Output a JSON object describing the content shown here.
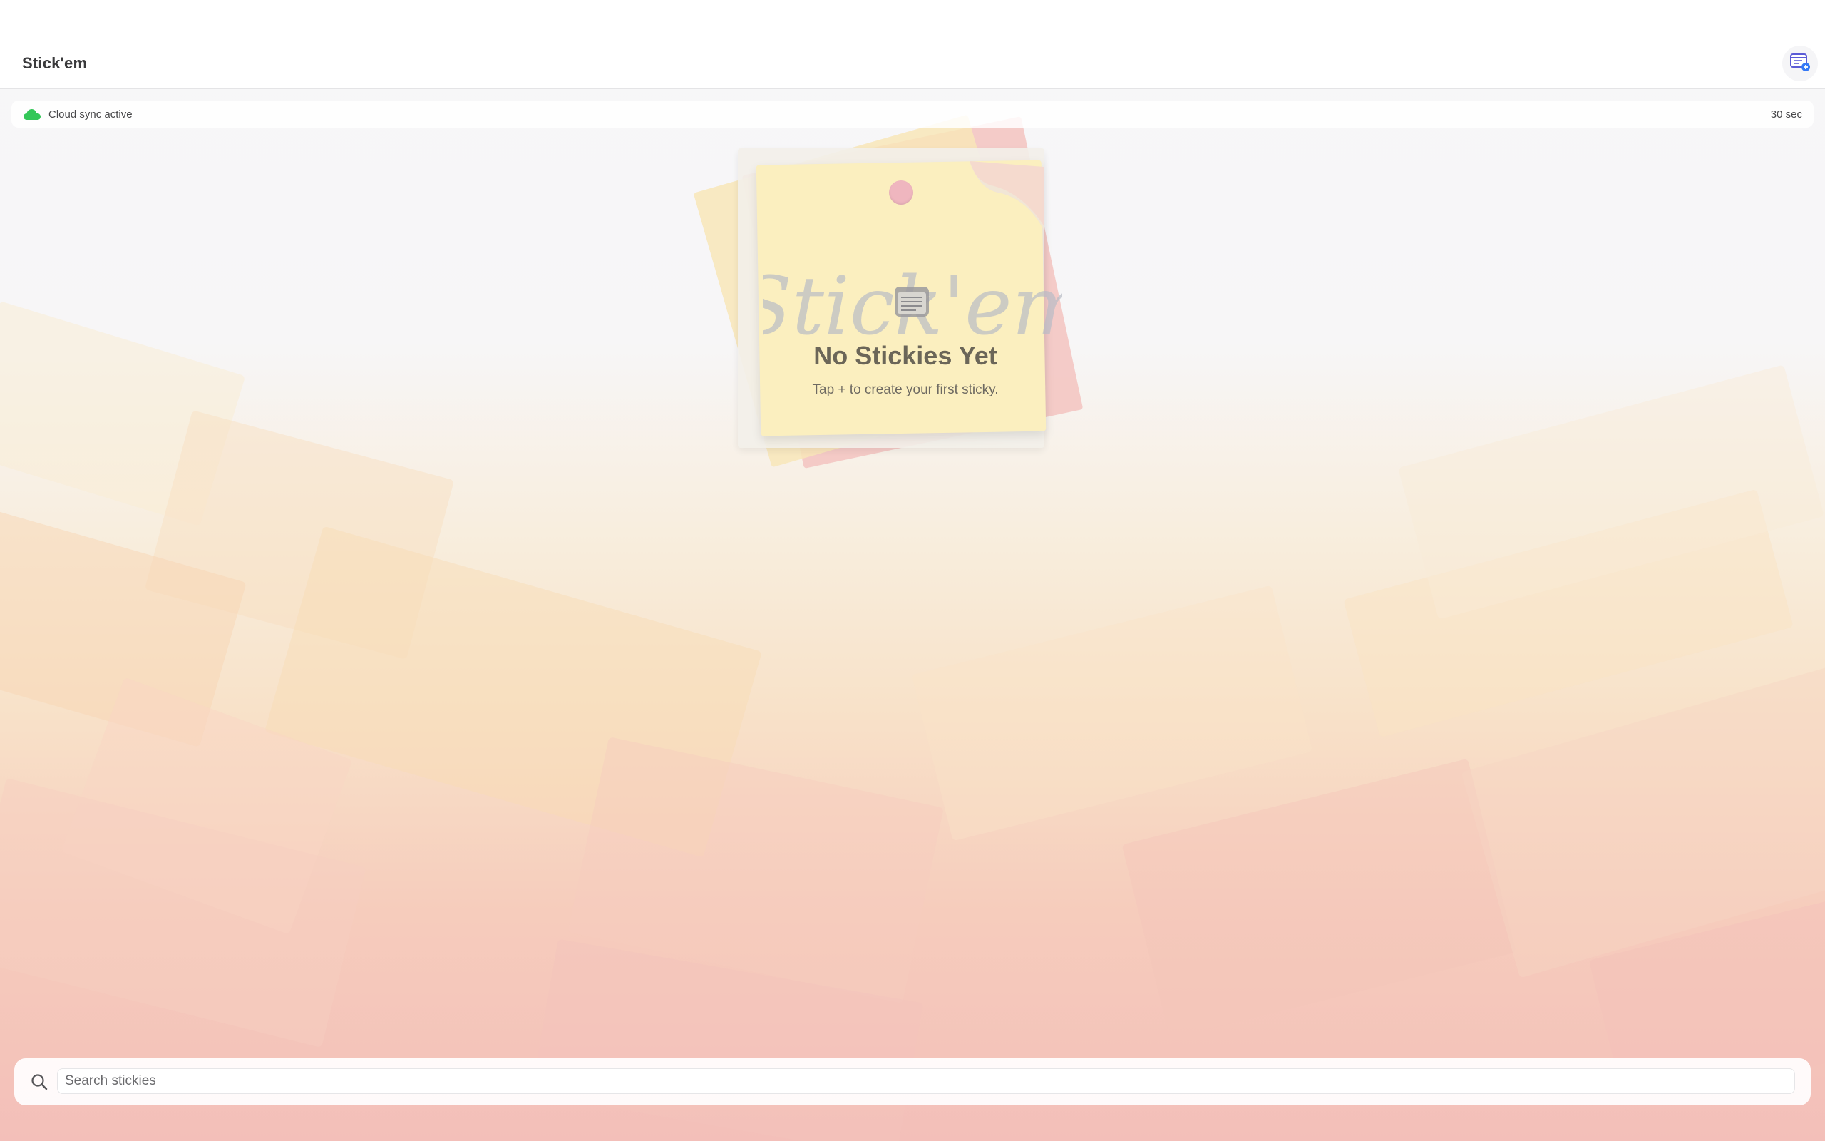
{
  "app": {
    "title": "Stick'em"
  },
  "header": {
    "new_sticky_icon": "note-plus-icon"
  },
  "sync": {
    "status_text": "Cloud sync active",
    "interval": "30 sec",
    "icon": "cloud-icon",
    "status_color": "#34c759"
  },
  "empty_state": {
    "watermark": "Stick'em",
    "icon": "note-lines-icon",
    "title": "No Stickies Yet",
    "subtitle": "Tap + to create your first sticky."
  },
  "search": {
    "placeholder": "Search stickies",
    "value": "",
    "icon": "search-icon"
  },
  "colors": {
    "accent": "#5b5bd6",
    "sticky_yellow": "#fbeeb0",
    "sticky_pink": "#f4b3b3"
  }
}
